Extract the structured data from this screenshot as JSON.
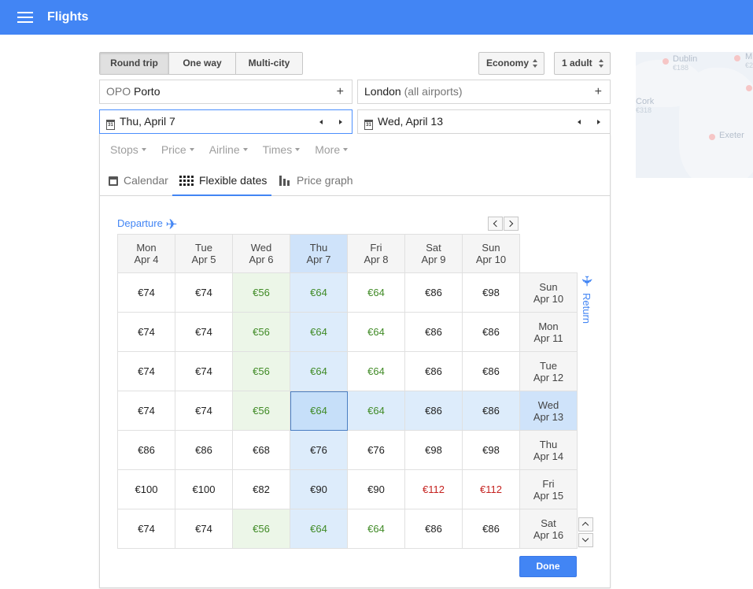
{
  "header": {
    "title": "Flights"
  },
  "trip_type": {
    "options": [
      "Round trip",
      "One way",
      "Multi-city"
    ],
    "selected": "Round trip"
  },
  "cabin_class": "Economy",
  "passengers": "1 adult",
  "origin": {
    "code": "OPO",
    "city": "Porto",
    "add": "+"
  },
  "destination": {
    "city": "London",
    "detail": "(all airports)",
    "add": "+"
  },
  "departure_date": {
    "icon_text": "31",
    "value": "Thu, April 7"
  },
  "return_date": {
    "icon_text": "31",
    "value": "Wed, April 13"
  },
  "filters": [
    "Stops",
    "Price",
    "Airline",
    "Times",
    "More"
  ],
  "tabs": [
    {
      "label": "Calendar",
      "icon": "calendar-icon"
    },
    {
      "label": "Flexible dates",
      "icon": "grid-icon",
      "active": true
    },
    {
      "label": "Price graph",
      "icon": "bar-chart-icon"
    }
  ],
  "flexible_dates": {
    "departure_label": "Departure",
    "return_label": "Return",
    "departure_days": [
      {
        "day": "Mon",
        "date": "Apr 4"
      },
      {
        "day": "Tue",
        "date": "Apr 5"
      },
      {
        "day": "Wed",
        "date": "Apr 6"
      },
      {
        "day": "Thu",
        "date": "Apr 7",
        "selected": true
      },
      {
        "day": "Fri",
        "date": "Apr 8"
      },
      {
        "day": "Sat",
        "date": "Apr 9"
      },
      {
        "day": "Sun",
        "date": "Apr 10"
      }
    ],
    "rows": [
      {
        "day": "Sun",
        "date": "Apr 10",
        "prices": [
          "€74",
          "€74",
          "€56",
          "€64",
          "€64",
          "€86",
          "€98"
        ]
      },
      {
        "day": "Mon",
        "date": "Apr 11",
        "prices": [
          "€74",
          "€74",
          "€56",
          "€64",
          "€64",
          "€86",
          "€86"
        ]
      },
      {
        "day": "Tue",
        "date": "Apr 12",
        "prices": [
          "€74",
          "€74",
          "€56",
          "€64",
          "€64",
          "€86",
          "€86"
        ]
      },
      {
        "day": "Wed",
        "date": "Apr 13",
        "selected": true,
        "prices": [
          "€74",
          "€74",
          "€56",
          "€64",
          "€64",
          "€86",
          "€86"
        ]
      },
      {
        "day": "Thu",
        "date": "Apr 14",
        "prices": [
          "€86",
          "€86",
          "€68",
          "€76",
          "€76",
          "€98",
          "€98"
        ]
      },
      {
        "day": "Fri",
        "date": "Apr 15",
        "prices": [
          "€100",
          "€100",
          "€82",
          "€90",
          "€90",
          "€112",
          "€112"
        ]
      },
      {
        "day": "Sat",
        "date": "Apr 16",
        "prices": [
          "€74",
          "€74",
          "€56",
          "€64",
          "€64",
          "€86",
          "€86"
        ]
      }
    ],
    "colors": {
      "low": "#3f8a25",
      "high": "#c5221f",
      "accent": "#4285f4"
    }
  },
  "done_label": "Done",
  "map": {
    "cities": [
      {
        "name": "Dublin",
        "price": "€188"
      },
      {
        "name": "M",
        "price": "€2"
      },
      {
        "name": "Cork",
        "price": "€318"
      },
      {
        "name": "Exeter",
        "price": ""
      }
    ]
  }
}
